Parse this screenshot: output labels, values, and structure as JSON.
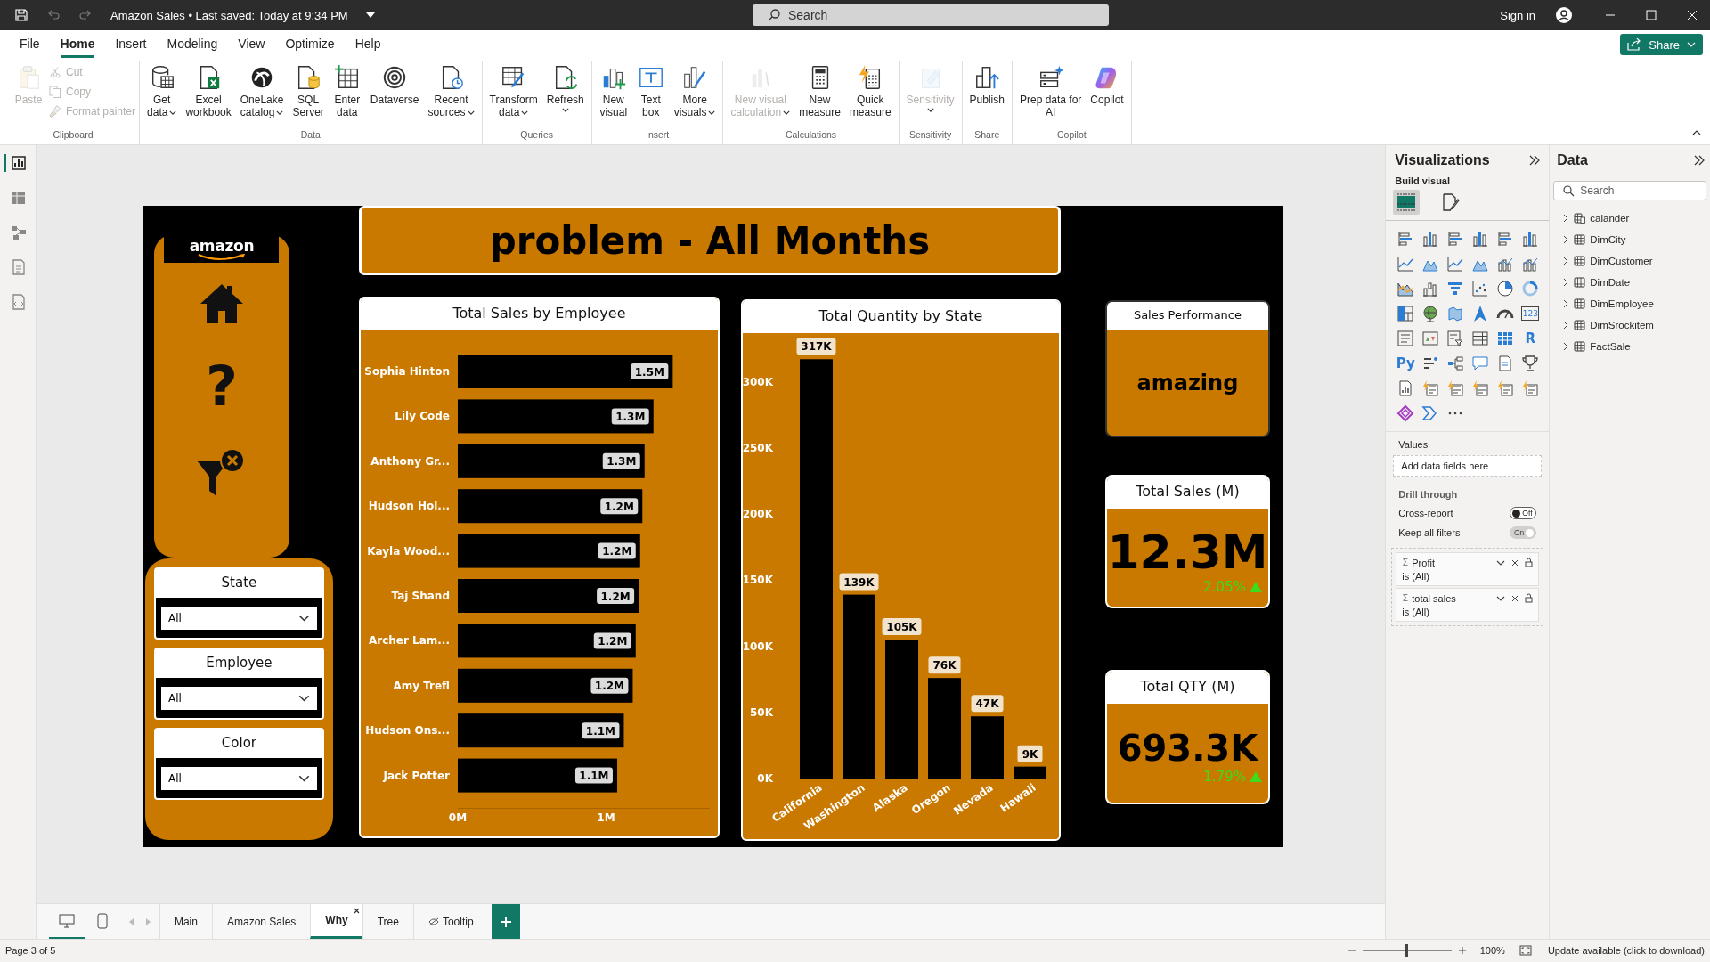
{
  "title_bar": {
    "document": "Amazon Sales • Last saved: Today at 9:34 PM",
    "search_placeholder": "Search",
    "sign_in": "Sign in"
  },
  "menu_tabs": [
    {
      "label": "File",
      "selected": false
    },
    {
      "label": "Home",
      "selected": true
    },
    {
      "label": "Insert",
      "selected": false
    },
    {
      "label": "Modeling",
      "selected": false
    },
    {
      "label": "View",
      "selected": false
    },
    {
      "label": "Optimize",
      "selected": false
    },
    {
      "label": "Help",
      "selected": false
    }
  ],
  "share_button": "Share",
  "ribbon": {
    "groups": [
      {
        "name": "Clipboard",
        "buttons": [
          {
            "kind": "large",
            "label": "Paste",
            "dropdown": false,
            "disabled": true
          },
          {
            "kind": "small",
            "label": "Cut",
            "dropdown": false,
            "disabled": true
          },
          {
            "kind": "small",
            "label": "Copy",
            "dropdown": false,
            "disabled": true
          },
          {
            "kind": "small",
            "label": "Format painter",
            "dropdown": false,
            "disabled": true
          }
        ]
      },
      {
        "name": "Data",
        "buttons": [
          {
            "kind": "large",
            "label": "Get\ndata",
            "dropdown": true,
            "disabled": false
          },
          {
            "kind": "large",
            "label": "Excel\nworkbook",
            "dropdown": false,
            "disabled": false
          },
          {
            "kind": "large",
            "label": "OneLake\ncatalog",
            "dropdown": true,
            "disabled": false
          },
          {
            "kind": "large",
            "label": "SQL\nServer",
            "dropdown": false,
            "disabled": false
          },
          {
            "kind": "large",
            "label": "Enter\ndata",
            "dropdown": false,
            "disabled": false
          },
          {
            "kind": "large",
            "label": "Dataverse",
            "dropdown": false,
            "disabled": false
          },
          {
            "kind": "large",
            "label": "Recent\nsources",
            "dropdown": true,
            "disabled": false
          }
        ]
      },
      {
        "name": "Queries",
        "buttons": [
          {
            "kind": "large",
            "label": "Transform\ndata",
            "dropdown": true,
            "disabled": false
          },
          {
            "kind": "large",
            "label": "Refresh",
            "dropdown": true,
            "disabled": false
          }
        ]
      },
      {
        "name": "Insert",
        "buttons": [
          {
            "kind": "large",
            "label": "New\nvisual",
            "dropdown": false,
            "disabled": false
          },
          {
            "kind": "large",
            "label": "Text\nbox",
            "dropdown": false,
            "disabled": false
          },
          {
            "kind": "large",
            "label": "More\nvisuals",
            "dropdown": true,
            "disabled": false
          }
        ]
      },
      {
        "name": "Calculations",
        "buttons": [
          {
            "kind": "large",
            "label": "New visual\ncalculation",
            "dropdown": true,
            "disabled": true
          },
          {
            "kind": "large",
            "label": "New\nmeasure",
            "dropdown": false,
            "disabled": false
          },
          {
            "kind": "large",
            "label": "Quick\nmeasure",
            "dropdown": false,
            "disabled": false
          }
        ]
      },
      {
        "name": "Sensitivity",
        "buttons": [
          {
            "kind": "large",
            "label": "Sensitivity",
            "dropdown": true,
            "disabled": true
          }
        ]
      },
      {
        "name": "Share",
        "buttons": [
          {
            "kind": "large",
            "label": "Publish",
            "dropdown": false,
            "disabled": false
          }
        ]
      },
      {
        "name": "Copilot",
        "buttons": [
          {
            "kind": "large",
            "label": "Prep data for\nAI",
            "dropdown": false,
            "disabled": false
          },
          {
            "kind": "large",
            "label": "Copilot",
            "dropdown": false,
            "disabled": false
          }
        ]
      }
    ]
  },
  "view_switcher": [
    {
      "selected": true
    },
    {
      "selected": false
    },
    {
      "selected": false
    },
    {
      "selected": false
    },
    {
      "selected": false
    }
  ],
  "report": {
    "title": "problem - All Months",
    "logo_text": "amazon",
    "nav_buttons": [
      {
        "kind": "home"
      },
      {
        "kind": "help",
        "glyph": "?"
      },
      {
        "kind": "clear"
      }
    ],
    "slicers": [
      {
        "title": "State",
        "value": "All"
      },
      {
        "title": "Employee",
        "value": "All"
      },
      {
        "title": "Color",
        "value": "All"
      }
    ],
    "charts": [
      {
        "title": "Total Sales by Employee",
        "chart_data": {
          "type": "bar",
          "orientation": "horizontal",
          "categories": [
            "Sophia Hinton",
            "Lily Code",
            "Anthony Gr...",
            "Hudson Hol...",
            "Kayla Wood...",
            "Taj Shand",
            "Archer Lam...",
            "Amy Trefl",
            "Hudson Ons...",
            "Jack Potter"
          ],
          "values": [
            1.45,
            1.32,
            1.26,
            1.245,
            1.23,
            1.22,
            1.2,
            1.18,
            1.12,
            1.075
          ],
          "xlim": [
            0,
            1.7
          ],
          "xticks": [
            {
              "value": 0,
              "label": "0M"
            },
            {
              "value": 1,
              "label": "1M"
            }
          ],
          "value_labels": [
            "1.5M",
            "1.3M",
            "1.3M",
            "1.2M",
            "1.2M",
            "1.2M",
            "1.2M",
            "1.2M",
            "1.1M",
            "1.1M"
          ]
        }
      },
      {
        "title": "Total Quantity by State",
        "chart_data": {
          "type": "bar",
          "orientation": "vertical",
          "categories": [
            "California",
            "Washington",
            "Alaska",
            "Oregon",
            "Nevada",
            "Hawaii"
          ],
          "values": [
            317000,
            139000,
            105000,
            76000,
            47000,
            9000
          ],
          "ylim": [
            0,
            330000
          ],
          "yticks": [
            {
              "value": 0,
              "label": "0K"
            },
            {
              "value": 50000,
              "label": "50K"
            },
            {
              "value": 100000,
              "label": "100K"
            },
            {
              "value": 150000,
              "label": "150K"
            },
            {
              "value": 200000,
              "label": "200K"
            },
            {
              "value": 250000,
              "label": "250K"
            },
            {
              "value": 300000,
              "label": "300K"
            }
          ],
          "value_labels": [
            "317K",
            "139K",
            "105K",
            "76K",
            "47K",
            "9K"
          ]
        }
      }
    ],
    "kpi_cards": [
      {
        "kind": "text",
        "title": "Sales Performance",
        "value": "amazing"
      },
      {
        "kind": "number",
        "title": "Total Sales (M)",
        "value": "12.3M",
        "change": "2.05%",
        "rising": true
      },
      {
        "kind": "number",
        "title": "Total QTY (M)",
        "value": "693.3K",
        "change": "1.79%",
        "rising": true
      }
    ]
  },
  "visualizations": {
    "title": "Visualizations",
    "build_visual": "Build visual",
    "build_tabs": [
      {
        "selected": true
      },
      {
        "selected": false
      }
    ],
    "visual_types": [
      {
        "kind": "hbar"
      },
      {
        "kind": "vbar"
      },
      {
        "kind": "hbar"
      },
      {
        "kind": "vbar"
      },
      {
        "kind": "hbar"
      },
      {
        "kind": "vbar"
      },
      {
        "kind": "line"
      },
      {
        "kind": "area"
      },
      {
        "kind": "line"
      },
      {
        "kind": "area"
      },
      {
        "kind": "combo"
      },
      {
        "kind": "combo"
      },
      {
        "kind": "ribbon"
      },
      {
        "kind": "waterfall"
      },
      {
        "kind": "funnel"
      },
      {
        "kind": "scatter"
      },
      {
        "kind": "pie"
      },
      {
        "kind": "donut"
      },
      {
        "kind": "treemap"
      },
      {
        "kind": "globe"
      },
      {
        "kind": "map"
      },
      {
        "kind": "arrow"
      },
      {
        "kind": "gauge"
      },
      {
        "kind": "card",
        "text": "123"
      },
      {
        "kind": "list"
      },
      {
        "kind": "kpi"
      },
      {
        "kind": "slicer"
      },
      {
        "kind": "table"
      },
      {
        "kind": "matrix"
      },
      {
        "kind": "text",
        "text": "R"
      },
      {
        "kind": "text",
        "text": "Py"
      },
      {
        "kind": "influencer"
      },
      {
        "kind": "tree"
      },
      {
        "kind": "speech"
      },
      {
        "kind": "doc"
      },
      {
        "kind": "trophy"
      },
      {
        "kind": "report"
      },
      {
        "kind": "power"
      },
      {
        "kind": "power"
      },
      {
        "kind": "power"
      },
      {
        "kind": "power"
      },
      {
        "kind": "power"
      },
      {
        "kind": "diamond"
      },
      {
        "kind": "chevron"
      },
      {
        "kind": "more"
      }
    ],
    "values_label": "Values",
    "values_placeholder": "Add data fields here",
    "drill_through": "Drill through",
    "toggles": [
      {
        "label": "Cross-report",
        "state_text": "Off",
        "on": false,
        "disabled": false
      },
      {
        "label": "Keep all filters",
        "state_text": "On",
        "on": true,
        "disabled": true
      }
    ],
    "filters": [
      {
        "glyph": "Σ",
        "field": "Profit",
        "condition": "is (All)"
      },
      {
        "glyph": "Σ",
        "field": "total sales",
        "condition": "is (All)"
      }
    ]
  },
  "data_pane": {
    "title": "Data",
    "search_placeholder": "Search",
    "tables": [
      {
        "kind": "calculated",
        "name": "calander",
        "expanded": false
      },
      {
        "kind": "table",
        "name": "DimCity",
        "expanded": false
      },
      {
        "kind": "table",
        "name": "DimCustomer",
        "expanded": false
      },
      {
        "kind": "table",
        "name": "DimDate",
        "expanded": false
      },
      {
        "kind": "table",
        "name": "DimEmployee",
        "expanded": false
      },
      {
        "kind": "table",
        "name": "DimSrockitem",
        "expanded": false
      },
      {
        "kind": "table",
        "name": "FactSale",
        "expanded": false
      }
    ]
  },
  "layout_buttons": [
    {
      "kind": "desktop",
      "selected": true
    },
    {
      "kind": "mobile",
      "selected": false
    }
  ],
  "pages": [
    {
      "label": "Main",
      "selected": false,
      "hidden": false
    },
    {
      "label": "Amazon Sales",
      "selected": false,
      "hidden": false
    },
    {
      "label": "Why",
      "selected": true,
      "hidden": false
    },
    {
      "label": "Tree",
      "selected": false,
      "hidden": false
    },
    {
      "label": "Tooltip",
      "selected": false,
      "hidden": true
    }
  ],
  "status_bar": {
    "page_indicator": "Page 3 of 5",
    "zoom": {
      "level": 0.5,
      "reading": "100%"
    },
    "update_notice": "Update available (click to download)"
  }
}
